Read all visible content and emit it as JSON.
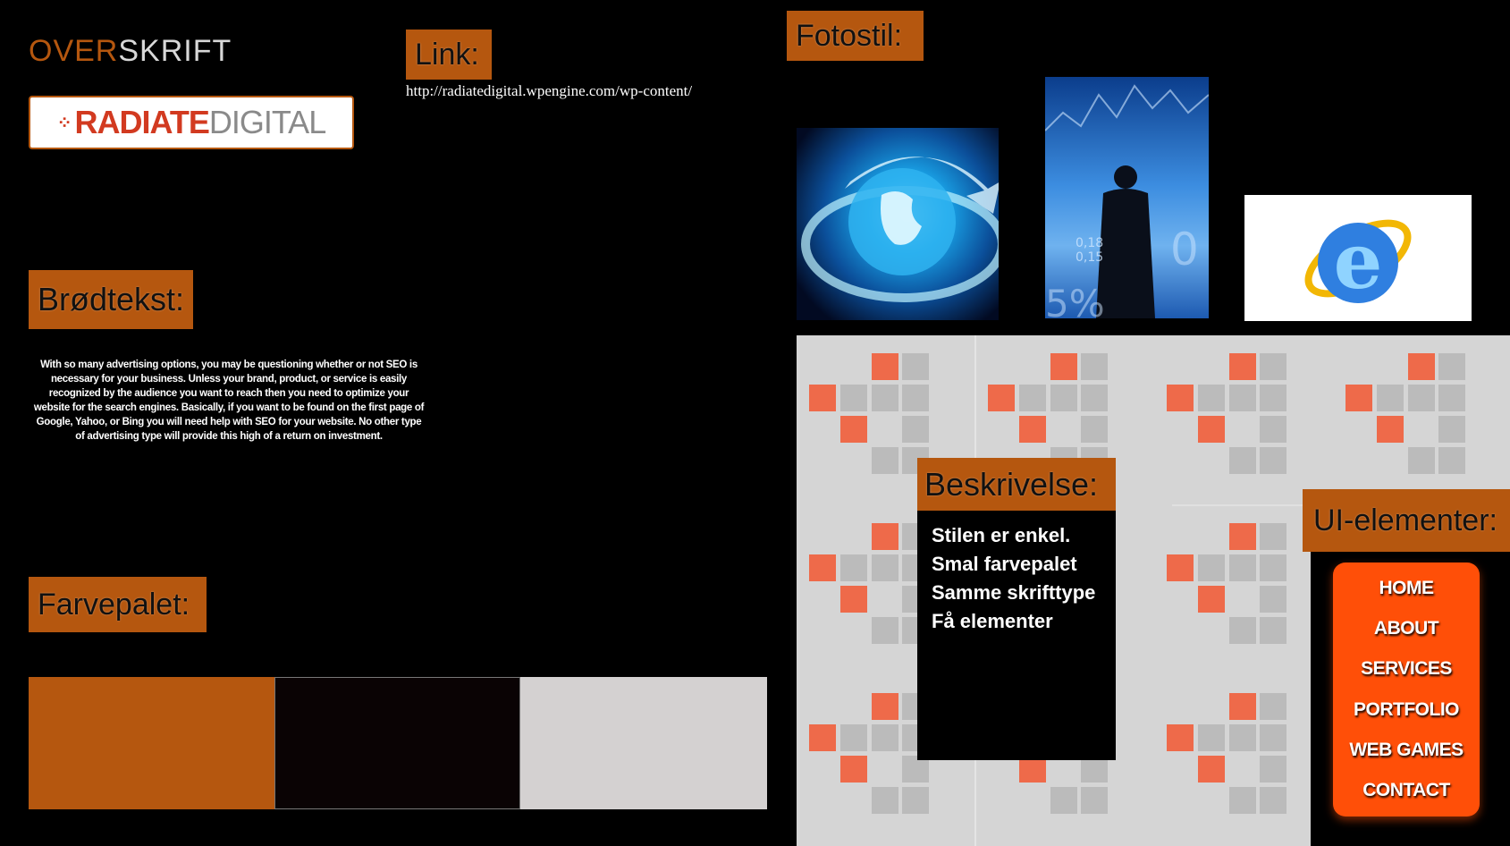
{
  "heading": {
    "part1": "OVER",
    "part2": "SKRIFT"
  },
  "logo": {
    "text_red": "RADIATE",
    "text_gray": "DIGITAL"
  },
  "labels": {
    "link": "Link:",
    "photo_style": "Fotostil:",
    "body_text": "Brødtekst:",
    "palette": "Farvepalet:",
    "description": "Beskrivelse:",
    "ui_elements": "UI-elementer:"
  },
  "link_url": "http://radiatedigital.wpengine.com/wp-content/",
  "body_paragraph": "With so many advertising options, you may be questioning whether or not SEO is necessary for your business. Unless your brand, product, or service is easily recognized by the audience you want to reach then you need to optimize your website for the search engines. Basically, if you want to be found on the first page of Google, Yahoo, or Bing you will need help with SEO for your website. No other type of advertising type will provide this high of a return on investment.",
  "palette_colors": [
    "#b5570f",
    "#0a0304",
    "#d4d1d1"
  ],
  "description_lines": [
    "Stilen er enkel.",
    "Smal farvepalet",
    "Samme skrifttype",
    "Få elementer"
  ],
  "nav_items": [
    "HOME",
    "ABOUT",
    "SERVICES",
    "PORTFOLIO",
    "WEB GAMES",
    "CONTACT"
  ],
  "photo_overlay": {
    "numbers": "0,18\n0,15",
    "percent": "5%",
    "digit": "0"
  },
  "icons": [
    "globe-arrow-photo",
    "businessman-chart-photo",
    "internet-explorer-logo",
    "square-pattern"
  ]
}
